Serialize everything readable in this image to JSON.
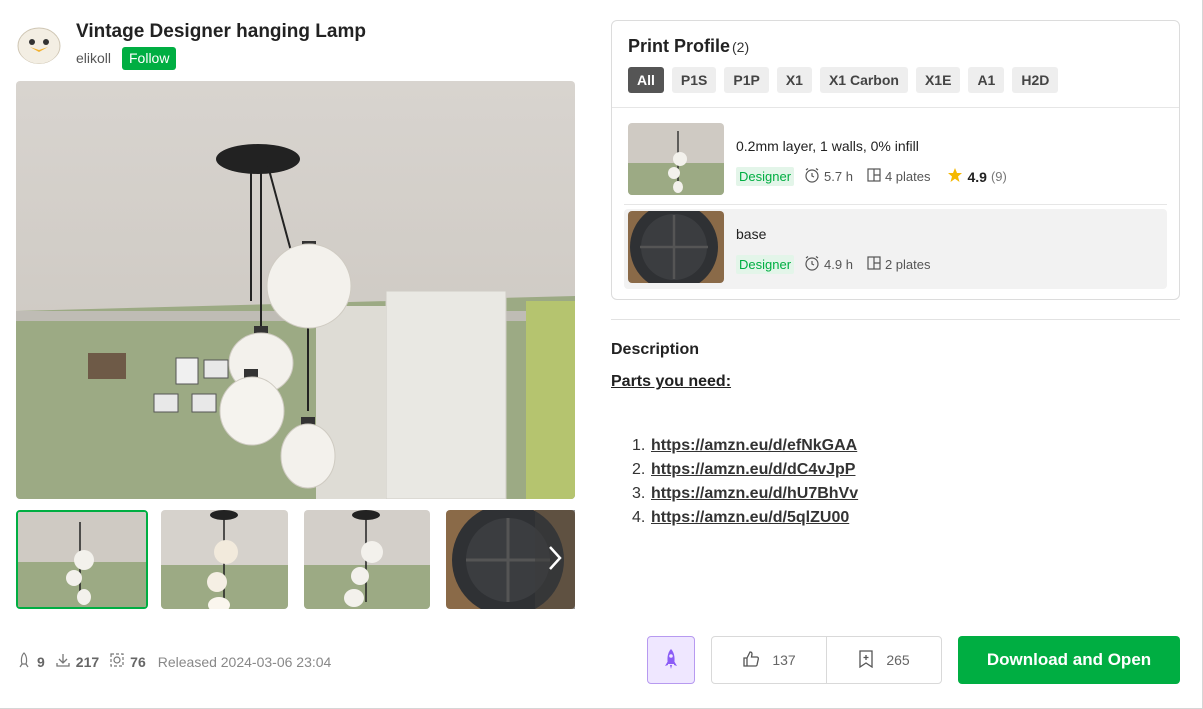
{
  "header": {
    "title": "Vintage Designer hanging Lamp",
    "author": "elikoll",
    "follow_label": "Follow"
  },
  "gallery": {
    "thumbnails": [
      "lamp-front",
      "lamp-side-lit",
      "lamp-front-2",
      "base-top"
    ],
    "next_icon": "chevron-right-icon"
  },
  "stats": {
    "boosts": "9",
    "downloads": "217",
    "prints": "76",
    "released": "Released 2024-03-06 23:04"
  },
  "print_profile": {
    "title": "Print Profile",
    "count": "(2)",
    "filters": [
      "All",
      "P1S",
      "P1P",
      "X1",
      "X1 Carbon",
      "X1E",
      "A1",
      "H2D"
    ],
    "active_filter": "All",
    "profiles": [
      {
        "name": "0.2mm layer, 1 walls, 0% infill",
        "badge": "Designer",
        "time": "5.7 h",
        "plates": "4 plates",
        "rating": "4.9",
        "rating_count": "(9)"
      },
      {
        "name": "base",
        "badge": "Designer",
        "time": "4.9 h",
        "plates": "2 plates"
      }
    ]
  },
  "description": {
    "title": "Description",
    "parts_title": "Parts you need:",
    "links": [
      {
        "num": "1.",
        "url": "https://amzn.eu/d/efNkGAA"
      },
      {
        "num": "2.",
        "url": "https://amzn.eu/d/dC4vJpP"
      },
      {
        "num": "3.",
        "url": "https://amzn.eu/d/hU7BhVv"
      },
      {
        "num": "4.",
        "url": "https://amzn.eu/d/5qlZU00"
      }
    ]
  },
  "actions": {
    "likes": "137",
    "collects": "265",
    "download_label": "Download and Open"
  },
  "colors": {
    "brand_green": "#00ae42",
    "boost_purple": "#8b5cf6"
  }
}
